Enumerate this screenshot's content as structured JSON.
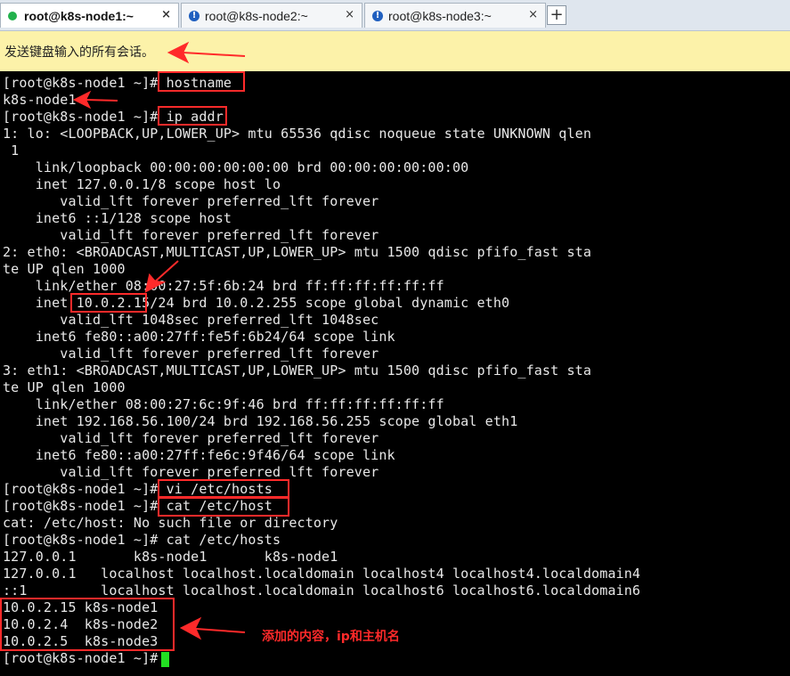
{
  "tabs": [
    {
      "label": "root@k8s-node1:~",
      "close": "×",
      "status": "connected"
    },
    {
      "label": "root@k8s-node2:~",
      "close": "×",
      "status": "warning"
    },
    {
      "label": "root@k8s-node3:~",
      "close": "×",
      "status": "warning"
    }
  ],
  "new_tab": "+",
  "banner": {
    "text": "发送键盘输入的所有会话。"
  },
  "terminal": {
    "lines": [
      "[root@k8s-node1 ~]# hostname",
      "k8s-node1",
      "[root@k8s-node1 ~]# ip addr",
      "1: lo: <LOOPBACK,UP,LOWER_UP> mtu 65536 qdisc noqueue state UNKNOWN qlen",
      " 1",
      "    link/loopback 00:00:00:00:00:00 brd 00:00:00:00:00:00",
      "    inet 127.0.0.1/8 scope host lo",
      "       valid_lft forever preferred_lft forever",
      "    inet6 ::1/128 scope host",
      "       valid_lft forever preferred_lft forever",
      "2: eth0: <BROADCAST,MULTICAST,UP,LOWER_UP> mtu 1500 qdisc pfifo_fast sta",
      "te UP qlen 1000",
      "    link/ether 08:00:27:5f:6b:24 brd ff:ff:ff:ff:ff:ff",
      "    inet 10.0.2.15/24 brd 10.0.2.255 scope global dynamic eth0",
      "       valid_lft 1048sec preferred_lft 1048sec",
      "    inet6 fe80::a00:27ff:fe5f:6b24/64 scope link",
      "       valid_lft forever preferred_lft forever",
      "3: eth1: <BROADCAST,MULTICAST,UP,LOWER_UP> mtu 1500 qdisc pfifo_fast sta",
      "te UP qlen 1000",
      "    link/ether 08:00:27:6c:9f:46 brd ff:ff:ff:ff:ff:ff",
      "    inet 192.168.56.100/24 brd 192.168.56.255 scope global eth1",
      "       valid_lft forever preferred_lft forever",
      "    inet6 fe80::a00:27ff:fe6c:9f46/64 scope link",
      "       valid_lft forever preferred_lft forever",
      "[root@k8s-node1 ~]# vi /etc/hosts",
      "[root@k8s-node1 ~]# cat /etc/host",
      "cat: /etc/host: No such file or directory",
      "[root@k8s-node1 ~]# cat /etc/hosts",
      "127.0.0.1       k8s-node1       k8s-node1",
      "127.0.0.1   localhost localhost.localdomain localhost4 localhost4.localdomain4",
      "::1         localhost localhost.localdomain localhost6 localhost6.localdomain6",
      "10.0.2.15 k8s-node1",
      "10.0.2.4  k8s-node2",
      "10.0.2.5  k8s-node3",
      "[root@k8s-node1 ~]# "
    ]
  },
  "annotation": {
    "text": "添加的内容，ip和主机名"
  },
  "colors": {
    "terminal_bg": "#000000",
    "terminal_fg": "#e8e8e8",
    "banner_bg": "#fcf2a9",
    "annotation": "#ff2a2a",
    "cursor": "#22e022"
  }
}
